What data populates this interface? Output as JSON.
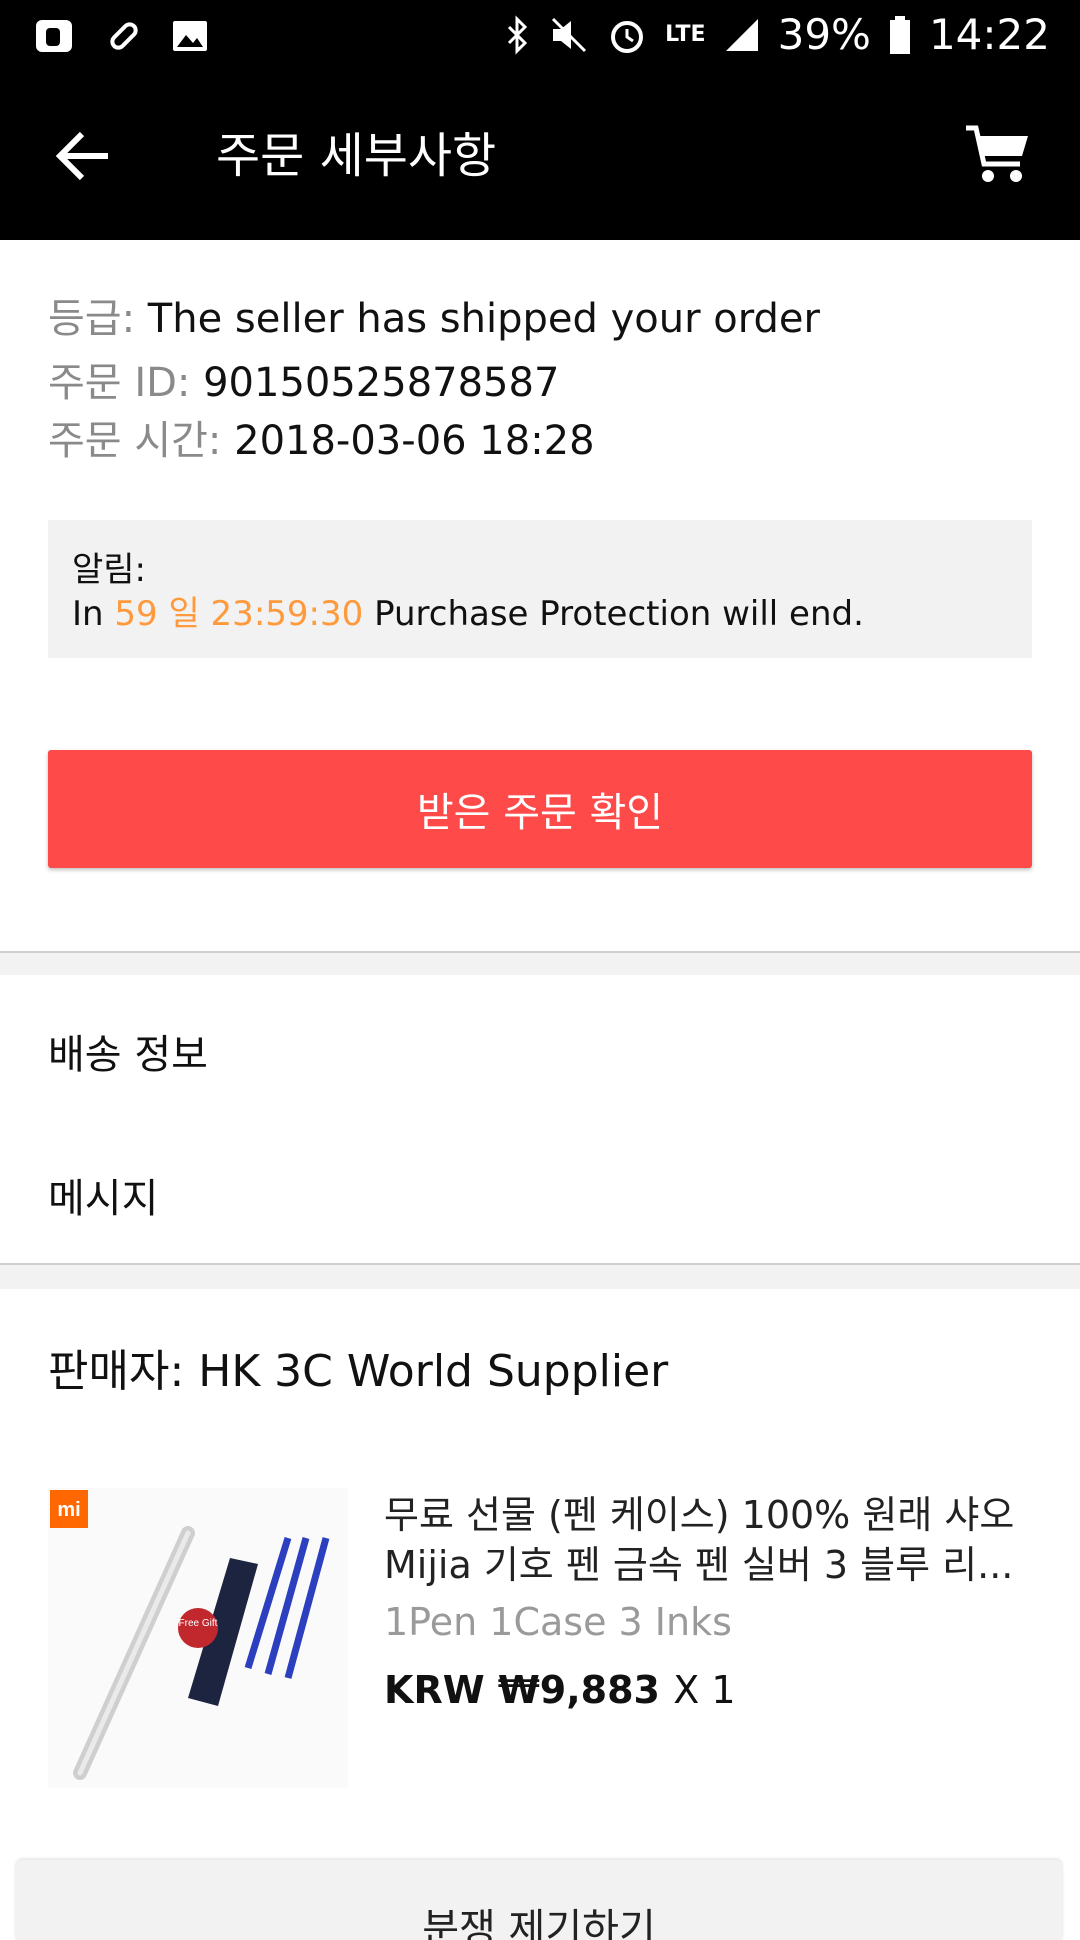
{
  "status_bar": {
    "battery": "39%",
    "time": "14:22",
    "network": "LTE"
  },
  "header": {
    "title": "주문 세부사항"
  },
  "order": {
    "status_label": "등급:",
    "status_value": "The seller has shipped your order",
    "id_label": "주문 ID:",
    "id_value": "90150525878587",
    "time_label": "주문 시간:",
    "time_value": "2018-03-06 18:28"
  },
  "notice": {
    "label": "알림:",
    "prefix": "In",
    "countdown": "59 일 23:59:30",
    "suffix": "Purchase Protection will end."
  },
  "confirm_button": "받은 주문 확인",
  "menu": {
    "shipping": "배송 정보",
    "message": "메시지"
  },
  "seller": {
    "label": "판매자: HK 3C World Supplier"
  },
  "product": {
    "brand": "mi",
    "gift_badge": "Free Gift",
    "title_line1": "무료 선물 (펜 케이스) 100% 원래 샤오",
    "title_line2": "Mijia 기호 펜 금속 펜 실버 3 블루 리...",
    "variant": "1Pen 1Case  3 Inks",
    "price": "KRW ₩9,883",
    "quantity": "X 1"
  },
  "bottom_button": "분쟁 제기하기",
  "colors": {
    "primary_button": "#ff4a4a",
    "countdown": "#ff9a3c",
    "appbar": "#000000"
  }
}
